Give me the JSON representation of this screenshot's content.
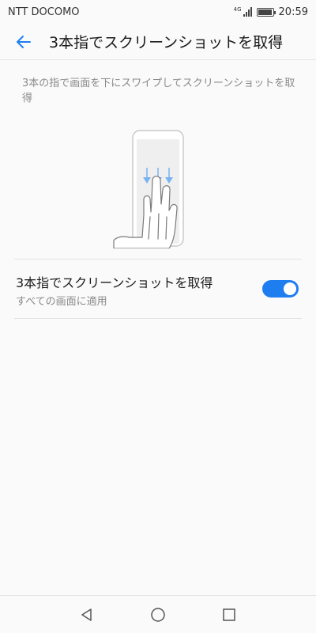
{
  "status_bar": {
    "carrier": "NTT DOCOMO",
    "network": "4G",
    "time": "20:59"
  },
  "app_bar": {
    "title": "3本指でスクリーンショットを取得",
    "back_icon": "arrow-left-icon"
  },
  "description": "3本の指で画面を下にスワイプしてスクリーンショットを取得",
  "setting": {
    "title": "3本指でスクリーンショットを取得",
    "subtitle": "すべての画面に適用",
    "enabled": true
  },
  "nav_bar": {
    "back_icon": "triangle-back-icon",
    "home_icon": "circle-home-icon",
    "recents_icon": "square-recents-icon"
  },
  "colors": {
    "accent": "#1e7ef0",
    "background": "#fafafa",
    "divider": "#e3e3e3",
    "secondary_text": "#8a8a8a"
  }
}
